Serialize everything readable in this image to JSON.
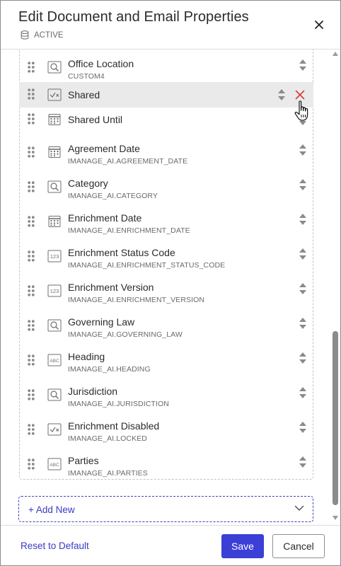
{
  "dialog": {
    "title": "Edit Document and Email Properties",
    "status": "ACTIVE"
  },
  "rows": [
    {
      "name": "Office Location",
      "code": "CUSTOM4",
      "icon": "search-field-icon"
    },
    {
      "name": "Shared",
      "code": "",
      "icon": "checkbox-field-icon"
    },
    {
      "name": "Shared Until",
      "code": "",
      "icon": "calendar-field-icon"
    },
    {
      "name": "Agreement Date",
      "code": "IMANAGE_AI.AGREEMENT_DATE",
      "icon": "calendar-field-icon"
    },
    {
      "name": "Category",
      "code": "IMANAGE_AI.CATEGORY",
      "icon": "search-field-icon"
    },
    {
      "name": "Enrichment Date",
      "code": "IMANAGE_AI.ENRICHMENT_DATE",
      "icon": "calendar-field-icon"
    },
    {
      "name": "Enrichment Status Code",
      "code": "IMANAGE_AI.ENRICHMENT_STATUS_CODE",
      "icon": "number-field-icon"
    },
    {
      "name": "Enrichment Version",
      "code": "IMANAGE_AI.ENRICHMENT_VERSION",
      "icon": "number-field-icon"
    },
    {
      "name": "Governing Law",
      "code": "IMANAGE_AI.GOVERNING_LAW",
      "icon": "search-field-icon"
    },
    {
      "name": "Heading",
      "code": "IMANAGE_AI.HEADING",
      "icon": "text-field-icon"
    },
    {
      "name": "Jurisdiction",
      "code": "IMANAGE_AI.JURISDICTION",
      "icon": "search-field-icon"
    },
    {
      "name": "Enrichment Disabled",
      "code": "IMANAGE_AI.LOCKED",
      "icon": "checkbox-field-icon"
    },
    {
      "name": "Parties",
      "code": "IMANAGE_AI.PARTIES",
      "icon": "text-field-icon"
    }
  ],
  "add_new": {
    "label": "+ Add New"
  },
  "footer": {
    "reset_label": "Reset to Default",
    "save_label": "Save",
    "cancel_label": "Cancel"
  },
  "colors": {
    "accent": "#3b3fd6",
    "link": "#3a3ac4",
    "remove": "#d93a3a",
    "row_highlight": "#eaeaea"
  }
}
